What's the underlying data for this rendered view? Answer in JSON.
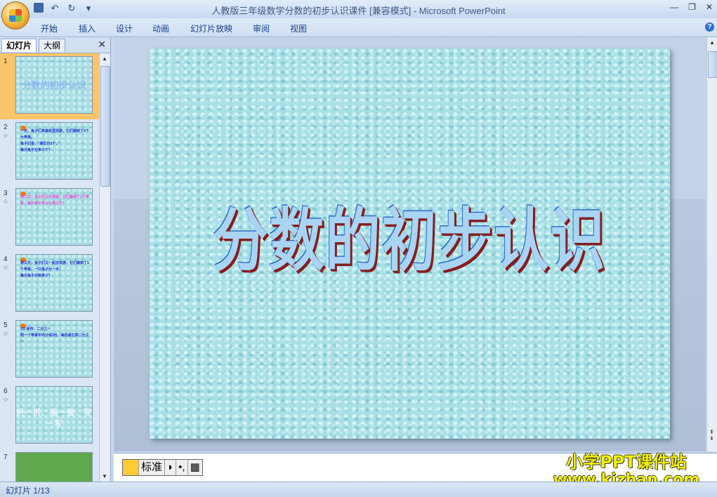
{
  "window": {
    "title": "人教版三年级数学分数的初步认识课件 [兼容模式] - Microsoft PowerPoint"
  },
  "quick_access": [
    "save-icon",
    "undo-icon",
    "redo-icon",
    "customize-icon"
  ],
  "window_controls": [
    "minimize-icon",
    "restore-icon",
    "close-icon"
  ],
  "menu": {
    "tabs": [
      "开始",
      "插入",
      "设计",
      "动画",
      "幻灯片放映",
      "审阅",
      "视图"
    ]
  },
  "left_pane": {
    "tabs": [
      "幻灯片",
      "大纲"
    ],
    "active_tab": "幻灯片",
    "slides": [
      {
        "num": "1",
        "text": "分数的初步认识",
        "kind": "title"
      },
      {
        "num": "2",
        "text": "一天，兔子们来森林里郊游，它们摘到了4个大苹果。\n兔子们说：“我们分2个，”\n每只兔子分多少个？",
        "kind": "text"
      },
      {
        "num": "3",
        "text": "第二天，兔子们又去郊游，它们摘到了2个苹果，每只兔子可以分到几个？",
        "kind": "pink"
      },
      {
        "num": "4",
        "text": "第三天，兔子们又一起去郊游，它们摘到了1个苹果，一只兔子分一半，\n每只兔子分到多少？",
        "kind": "text"
      },
      {
        "num": "5",
        "text": "1/2  读作：二分之一\n把一个苹果平均分成2份，每份是它的二分之一",
        "kind": "text"
      },
      {
        "num": "6",
        "text": "折一折、画一画、写一写",
        "kind": "light"
      },
      {
        "num": "7",
        "text": "",
        "kind": "image"
      }
    ]
  },
  "slide": {
    "title": "分数的初步认识"
  },
  "ime": {
    "mode": "标准",
    "items": [
      "ime-logo-icon",
      "half-moon-icon",
      "punctuation-icon",
      "keyboard-icon"
    ]
  },
  "watermark": {
    "line1": "小学PPT课件站",
    "line2": "www.kjzhan.com"
  },
  "status": {
    "slide_count": "幻灯片 1/13"
  }
}
